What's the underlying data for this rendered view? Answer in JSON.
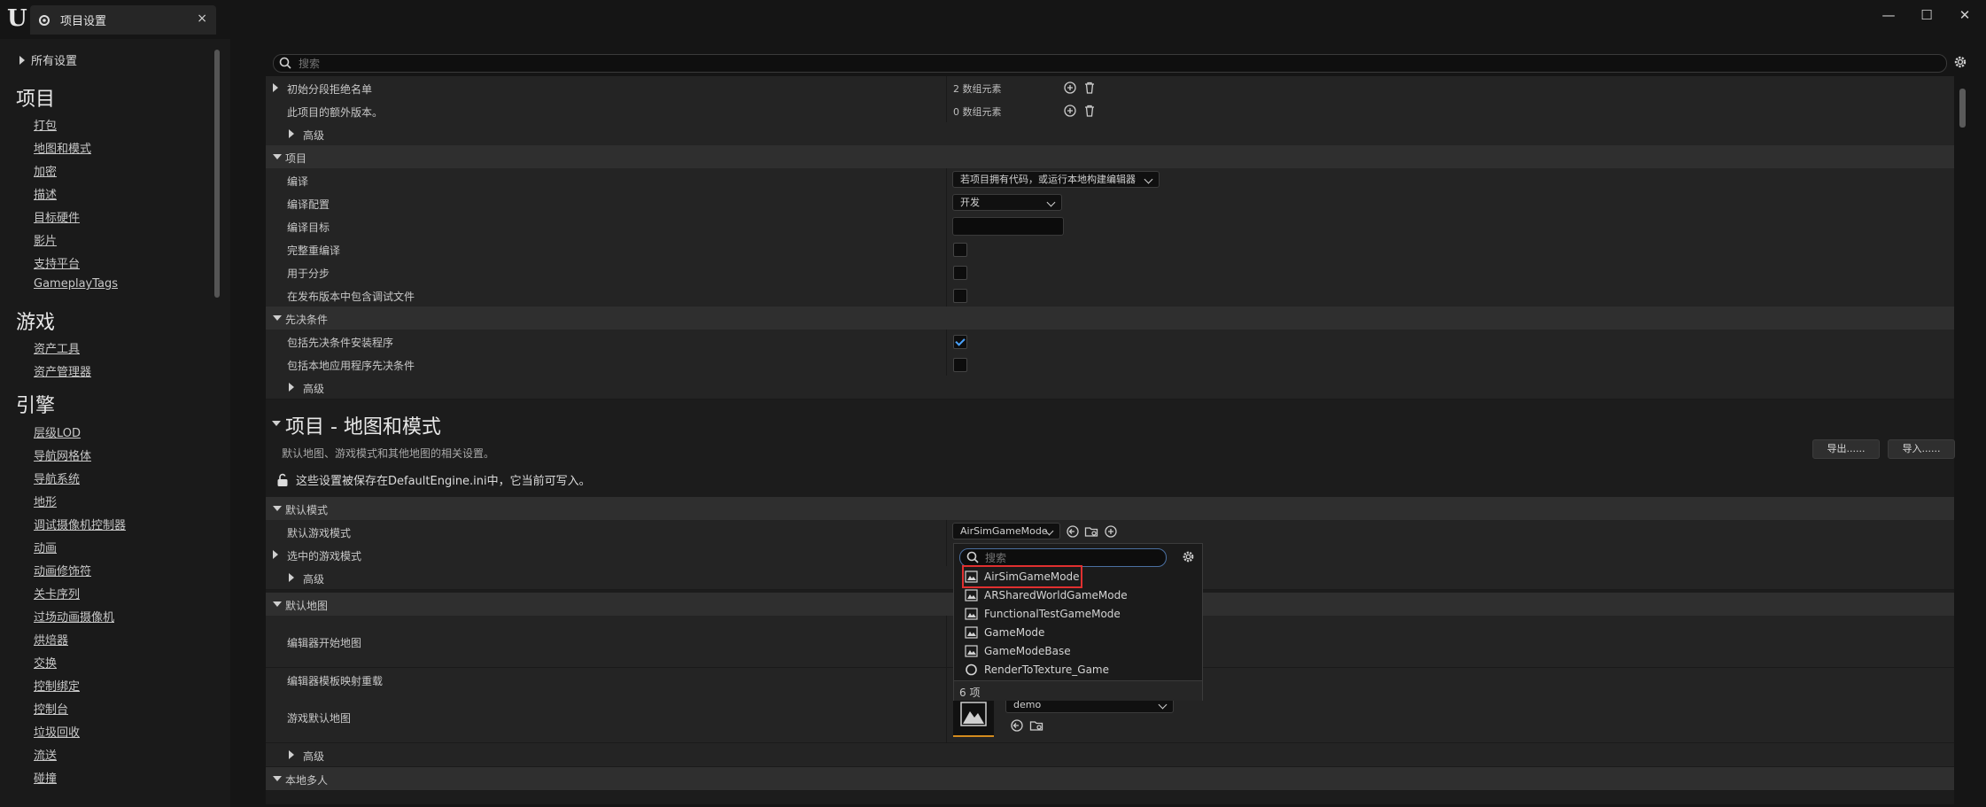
{
  "window": {
    "tab_title": "项目设置",
    "close_glyph": "×",
    "minimize_glyph": "—",
    "maximize_glyph": "☐",
    "close_window_glyph": "✕"
  },
  "sidebar": {
    "all_settings": "所有设置",
    "groups": [
      {
        "title": "项目",
        "items": [
          "打包",
          "地图和模式",
          "加密",
          "描述",
          "目标硬件",
          "影片",
          "支持平台",
          "GameplayTags"
        ]
      },
      {
        "title": "游戏",
        "items": [
          "资产工具",
          "资产管理器"
        ]
      },
      {
        "title": "引擎",
        "items": [
          "层级LOD",
          "导航网格体",
          "导航系统",
          "地形",
          "调试摄像机控制器",
          "动画",
          "动画修饰符",
          "关卡序列",
          "过场动画摄像机",
          "烘焙器",
          "交换",
          "控制绑定",
          "控制台",
          "垃圾回收",
          "流送",
          "碰撞"
        ]
      }
    ]
  },
  "search": {
    "placeholder": "搜索"
  },
  "rows": {
    "r1_label": "初始分段拒绝名单",
    "r1_value": "2 数组元素",
    "r2_label": "此项目的额外版本。",
    "r2_value": "0 数组元素",
    "advanced": "高级",
    "project_section": "项目",
    "build_label": "编译",
    "build_value": "若项目拥有代码，或运行本地构建编辑器",
    "build_config_label": "编译配置",
    "build_config_value": "开发",
    "build_target_label": "编译目标",
    "full_rebuild_label": "完整重编译",
    "for_distribution_label": "用于分步",
    "include_debug_label": "在发布版本中包含调试文件",
    "prereq_section": "先决条件",
    "include_prereq_installer_label": "包括先决条件安装程序",
    "include_app_local_prereq_label": "包括本地应用程序先决条件"
  },
  "maps_modes": {
    "title": "项目 - 地图和模式",
    "description": "默认地图、游戏模式和其他地图的相关设置。",
    "lock_notice": "这些设置被保存在DefaultEngine.ini中，它当前可写入。",
    "export_button": "导出......",
    "import_button": "导入......",
    "default_modes_section": "默认模式",
    "default_game_mode_label": "默认游戏模式",
    "default_game_mode_value": "AirSimGameMode",
    "selected_game_mode_label": "选中的游戏模式",
    "default_maps_section": "默认地图",
    "editor_startup_map_label": "编辑器开始地图",
    "editor_template_map_label": "编辑器模板映射重载",
    "game_default_map_label": "游戏默认地图",
    "game_default_map_value": "demo",
    "local_multiplayer_section": "本地多人"
  },
  "popup": {
    "search_placeholder": "搜索",
    "items": [
      "AirSimGameMode",
      "ARSharedWorldGameMode",
      "FunctionalTestGameMode",
      "GameMode",
      "GameModeBase",
      "RenderToTexture_Game"
    ],
    "selected": "AirSimGameMode",
    "count_label": "6 项"
  },
  "colors": {
    "accent_blue": "#4aa3ff",
    "highlight_red": "#e03030",
    "thumbnail_underline": "#d38b1e"
  }
}
